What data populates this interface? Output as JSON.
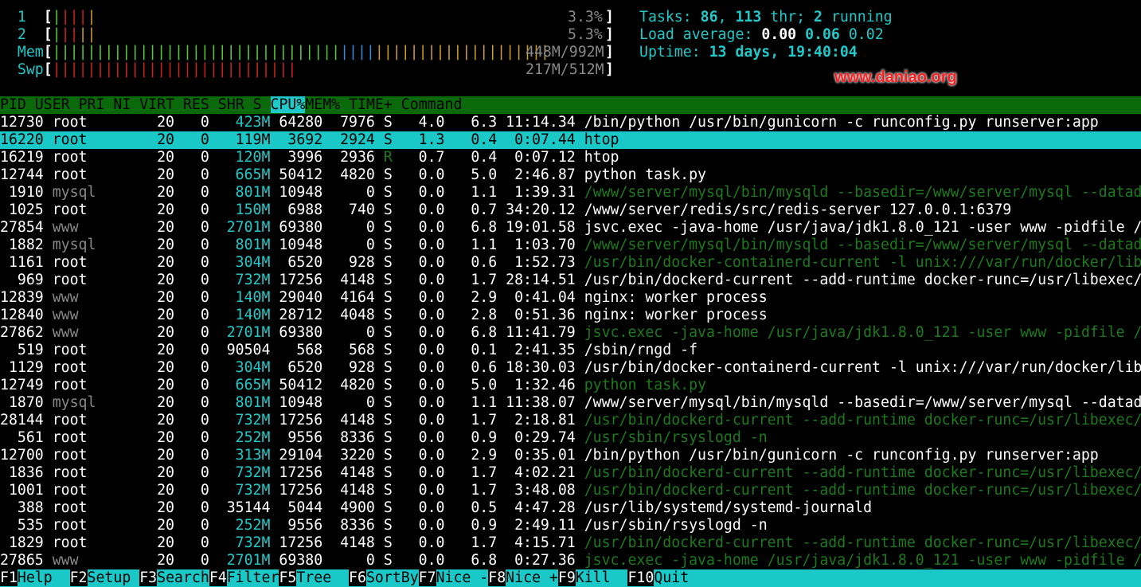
{
  "meters": {
    "cpu1": {
      "label": "1",
      "value": "3.3%"
    },
    "cpu2": {
      "label": "2",
      "value": "5.3%"
    },
    "mem": {
      "label": "Mem",
      "value": "448M/992M"
    },
    "swp": {
      "label": "Swp",
      "value": "217M/512M"
    }
  },
  "summary": {
    "tasks_label": "Tasks:",
    "tasks": "86",
    "thr": "113",
    "thr_label": "thr;",
    "running": "2",
    "running_label": "running",
    "load_label": "Load average:",
    "load1": "0.00",
    "load5": "0.06",
    "load15": "0.02",
    "uptime_label": "Uptime:",
    "uptime": "13 days, 19:40:04"
  },
  "watermark": "www.daniao.org",
  "columns": [
    "PID",
    "USER",
    "PRI",
    "NI",
    "VIRT",
    "RES",
    "SHR",
    "S",
    "CPU%",
    "MEM%",
    "TIME+",
    "Command"
  ],
  "processes": [
    {
      "pid": "12730",
      "user": "root",
      "pri": "20",
      "ni": "0",
      "virt": "423M",
      "res": "64280",
      "shr": "7976",
      "s": "S",
      "cpu": "4.0",
      "mem": "6.3",
      "time": "11:14.34",
      "cmd": "/bin/python /usr/bin/gunicorn -c runconfig.py runserver:app",
      "thread": false
    },
    {
      "pid": "16220",
      "user": "root",
      "pri": "20",
      "ni": "0",
      "virt": "119M",
      "res": "3692",
      "shr": "2924",
      "s": "S",
      "cpu": "1.3",
      "mem": "0.4",
      "time": "0:07.44",
      "cmd": "htop",
      "thread": false,
      "selected": true
    },
    {
      "pid": "16219",
      "user": "root",
      "pri": "20",
      "ni": "0",
      "virt": "120M",
      "res": "3996",
      "shr": "2936",
      "s": "R",
      "cpu": "0.7",
      "mem": "0.4",
      "time": "0:07.12",
      "cmd": "htop",
      "thread": false
    },
    {
      "pid": "12744",
      "user": "root",
      "pri": "20",
      "ni": "0",
      "virt": "665M",
      "res": "50412",
      "shr": "4820",
      "s": "S",
      "cpu": "0.0",
      "mem": "5.0",
      "time": "2:46.87",
      "cmd": "python task.py",
      "thread": false
    },
    {
      "pid": "1910",
      "user": "mysql",
      "pri": "20",
      "ni": "0",
      "virt": "801M",
      "res": "10948",
      "shr": "0",
      "s": "S",
      "cpu": "0.0",
      "mem": "1.1",
      "time": "1:39.31",
      "cmd": "/www/server/mysql/bin/mysqld --basedir=/www/server/mysql --datadir=/",
      "thread": true
    },
    {
      "pid": "1025",
      "user": "root",
      "pri": "20",
      "ni": "0",
      "virt": "150M",
      "res": "6988",
      "shr": "740",
      "s": "S",
      "cpu": "0.0",
      "mem": "0.7",
      "time": "34:20.12",
      "cmd": "/www/server/redis/src/redis-server 127.0.0.1:6379",
      "thread": false
    },
    {
      "pid": "27854",
      "user": "www",
      "pri": "20",
      "ni": "0",
      "virt": "2701M",
      "res": "69380",
      "shr": "0",
      "s": "S",
      "cpu": "0.0",
      "mem": "6.8",
      "time": "19:01.58",
      "cmd": "jsvc.exec -java-home /usr/java/jdk1.8.0_121 -user www -pidfile /www/",
      "thread": false
    },
    {
      "pid": "1882",
      "user": "mysql",
      "pri": "20",
      "ni": "0",
      "virt": "801M",
      "res": "10948",
      "shr": "0",
      "s": "S",
      "cpu": "0.0",
      "mem": "1.1",
      "time": "1:03.70",
      "cmd": "/www/server/mysql/bin/mysqld --basedir=/www/server/mysql --datadir=/",
      "thread": true
    },
    {
      "pid": "1161",
      "user": "root",
      "pri": "20",
      "ni": "0",
      "virt": "304M",
      "res": "6520",
      "shr": "928",
      "s": "S",
      "cpu": "0.0",
      "mem": "0.6",
      "time": "1:52.73",
      "cmd": "/usr/bin/docker-containerd-current -l unix:///var/run/docker/libcont",
      "thread": true
    },
    {
      "pid": "969",
      "user": "root",
      "pri": "20",
      "ni": "0",
      "virt": "732M",
      "res": "17256",
      "shr": "4148",
      "s": "S",
      "cpu": "0.0",
      "mem": "1.7",
      "time": "28:14.51",
      "cmd": "/usr/bin/dockerd-current --add-runtime docker-runc=/usr/libexec/dock",
      "thread": false
    },
    {
      "pid": "12839",
      "user": "www",
      "pri": "20",
      "ni": "0",
      "virt": "140M",
      "res": "29040",
      "shr": "4164",
      "s": "S",
      "cpu": "0.0",
      "mem": "2.9",
      "time": "0:41.04",
      "cmd": "nginx: worker process",
      "thread": false
    },
    {
      "pid": "12840",
      "user": "www",
      "pri": "20",
      "ni": "0",
      "virt": "140M",
      "res": "28712",
      "shr": "4048",
      "s": "S",
      "cpu": "0.0",
      "mem": "2.8",
      "time": "0:51.36",
      "cmd": "nginx: worker process",
      "thread": false
    },
    {
      "pid": "27862",
      "user": "www",
      "pri": "20",
      "ni": "0",
      "virt": "2701M",
      "res": "69380",
      "shr": "0",
      "s": "S",
      "cpu": "0.0",
      "mem": "6.8",
      "time": "11:41.79",
      "cmd": "jsvc.exec -java-home /usr/java/jdk1.8.0_121 -user www -pidfile /www/",
      "thread": true
    },
    {
      "pid": "519",
      "user": "root",
      "pri": "20",
      "ni": "0",
      "virt": "90504",
      "res": "568",
      "shr": "568",
      "s": "S",
      "cpu": "0.0",
      "mem": "0.1",
      "time": "2:41.35",
      "cmd": "/sbin/rngd -f",
      "thread": false
    },
    {
      "pid": "1129",
      "user": "root",
      "pri": "20",
      "ni": "0",
      "virt": "304M",
      "res": "6520",
      "shr": "928",
      "s": "S",
      "cpu": "0.0",
      "mem": "0.6",
      "time": "18:30.03",
      "cmd": "/usr/bin/docker-containerd-current -l unix:///var/run/docker/libcont",
      "thread": false
    },
    {
      "pid": "12749",
      "user": "root",
      "pri": "20",
      "ni": "0",
      "virt": "665M",
      "res": "50412",
      "shr": "4820",
      "s": "S",
      "cpu": "0.0",
      "mem": "5.0",
      "time": "1:32.46",
      "cmd": "python task.py",
      "thread": true
    },
    {
      "pid": "1870",
      "user": "mysql",
      "pri": "20",
      "ni": "0",
      "virt": "801M",
      "res": "10948",
      "shr": "0",
      "s": "S",
      "cpu": "0.0",
      "mem": "1.1",
      "time": "11:38.07",
      "cmd": "/www/server/mysql/bin/mysqld --basedir=/www/server/mysql --datadir=/",
      "thread": false
    },
    {
      "pid": "28144",
      "user": "root",
      "pri": "20",
      "ni": "0",
      "virt": "732M",
      "res": "17256",
      "shr": "4148",
      "s": "S",
      "cpu": "0.0",
      "mem": "1.7",
      "time": "2:18.81",
      "cmd": "/usr/bin/dockerd-current --add-runtime docker-runc=/usr/libexec/dock",
      "thread": true
    },
    {
      "pid": "561",
      "user": "root",
      "pri": "20",
      "ni": "0",
      "virt": "252M",
      "res": "9556",
      "shr": "8336",
      "s": "S",
      "cpu": "0.0",
      "mem": "0.9",
      "time": "0:29.74",
      "cmd": "/usr/sbin/rsyslogd -n",
      "thread": true
    },
    {
      "pid": "12700",
      "user": "root",
      "pri": "20",
      "ni": "0",
      "virt": "313M",
      "res": "29104",
      "shr": "3220",
      "s": "S",
      "cpu": "0.0",
      "mem": "2.9",
      "time": "0:35.01",
      "cmd": "/bin/python /usr/bin/gunicorn -c runconfig.py runserver:app",
      "thread": false
    },
    {
      "pid": "1836",
      "user": "root",
      "pri": "20",
      "ni": "0",
      "virt": "732M",
      "res": "17256",
      "shr": "4148",
      "s": "S",
      "cpu": "0.0",
      "mem": "1.7",
      "time": "4:02.21",
      "cmd": "/usr/bin/dockerd-current --add-runtime docker-runc=/usr/libexec/dock",
      "thread": true
    },
    {
      "pid": "1001",
      "user": "root",
      "pri": "20",
      "ni": "0",
      "virt": "732M",
      "res": "17256",
      "shr": "4148",
      "s": "S",
      "cpu": "0.0",
      "mem": "1.7",
      "time": "3:48.08",
      "cmd": "/usr/bin/dockerd-current --add-runtime docker-runc=/usr/libexec/dock",
      "thread": true
    },
    {
      "pid": "388",
      "user": "root",
      "pri": "20",
      "ni": "0",
      "virt": "35144",
      "res": "5044",
      "shr": "4900",
      "s": "S",
      "cpu": "0.0",
      "mem": "0.5",
      "time": "4:47.28",
      "cmd": "/usr/lib/systemd/systemd-journald",
      "thread": false
    },
    {
      "pid": "535",
      "user": "root",
      "pri": "20",
      "ni": "0",
      "virt": "252M",
      "res": "9556",
      "shr": "8336",
      "s": "S",
      "cpu": "0.0",
      "mem": "0.9",
      "time": "2:49.11",
      "cmd": "/usr/sbin/rsyslogd -n",
      "thread": false
    },
    {
      "pid": "1829",
      "user": "root",
      "pri": "20",
      "ni": "0",
      "virt": "732M",
      "res": "17256",
      "shr": "4148",
      "s": "S",
      "cpu": "0.0",
      "mem": "1.7",
      "time": "4:15.71",
      "cmd": "/usr/bin/dockerd-current --add-runtime docker-runc=/usr/libexec/dock",
      "thread": true
    },
    {
      "pid": "27865",
      "user": "www",
      "pri": "20",
      "ni": "0",
      "virt": "2701M",
      "res": "69380",
      "shr": "0",
      "s": "S",
      "cpu": "0.0",
      "mem": "6.8",
      "time": "0:27.36",
      "cmd": "jsvc.exec -java-home /usr/java/jdk1.8.0_121 -user www -pidfile /www/",
      "thread": true
    }
  ],
  "footer": [
    {
      "key": "F1",
      "label": "Help"
    },
    {
      "key": "F2",
      "label": "Setup"
    },
    {
      "key": "F3",
      "label": "Search"
    },
    {
      "key": "F4",
      "label": "Filter"
    },
    {
      "key": "F5",
      "label": "Tree"
    },
    {
      "key": "F6",
      "label": "SortBy"
    },
    {
      "key": "F7",
      "label": "Nice -"
    },
    {
      "key": "F8",
      "label": "Nice +"
    },
    {
      "key": "F9",
      "label": "Kill"
    },
    {
      "key": "F10",
      "label": "Quit"
    }
  ]
}
